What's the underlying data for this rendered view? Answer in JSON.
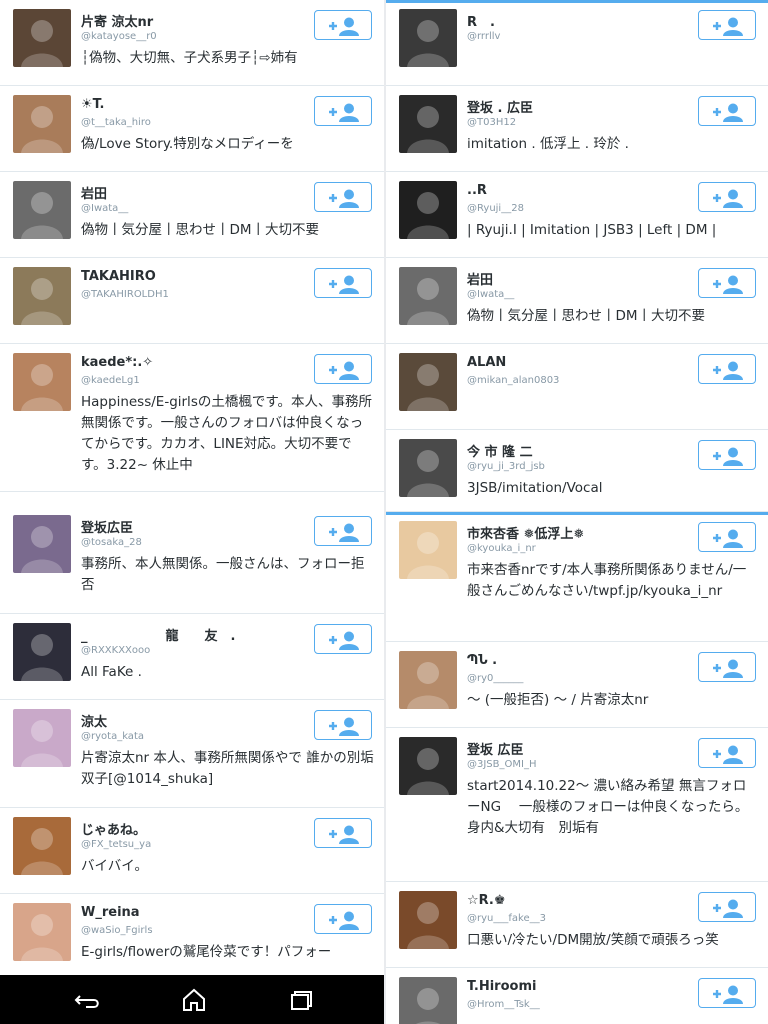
{
  "panels": {
    "top_left": [
      {
        "name": "片寄 涼太nr",
        "handle": "@katayose__r0",
        "bio": "┆偽物、大切無、子犬系男子┆⇨姉有",
        "avatar_color": "#5b4636"
      },
      {
        "name": "☀T.",
        "handle": "@t__taka_hiro",
        "bio": "偽/Love Story.特別なメロディーを",
        "avatar_color": "#a97c5a"
      },
      {
        "name": "岩田",
        "handle": "@Iwata__",
        "bio": "偽物丨気分屋丨思わせ丨DM丨大切不要",
        "avatar_color": "#6b6b6b"
      },
      {
        "name": "TAKAHIRO",
        "handle": "@TAKAHIROLDH1",
        "bio": "",
        "avatar_color": "#8c7a5a"
      },
      {
        "name": "kaede*:.✧",
        "handle": "@kaedeLg1",
        "bio": "Happiness/E-girlsの土橋楓です。本人、事務所無関係です。一般さんのフォロバは仲良くなってからです。カカオ、LINE対応。大切不要です。3.22~ 休止中",
        "avatar_color": "#b7835f"
      }
    ],
    "bottom_left": [
      {
        "name": "登坂広臣",
        "handle": "@tosaka_28",
        "bio": "事務所、本人無関係。一般さんは、フォロー拒否",
        "avatar_color": "#7a6a8e"
      },
      {
        "name": "_　　　　　　龍　　友　.",
        "handle": "@RXXKXXooo",
        "bio": "All FaKe .",
        "avatar_color": "#2d2d3a"
      },
      {
        "name": "涼太",
        "handle": "@ryota_kata",
        "bio": "片寄涼太nr 本人、事務所無関係やで 誰かの別垢 双子[@1014_shuka]",
        "avatar_color": "#c9a9c9"
      },
      {
        "name": "じゃあね。",
        "handle": "@FX_tetsu_ya",
        "bio": "バイバイ。",
        "avatar_color": "#a86a3a"
      },
      {
        "name": "W_reina",
        "handle": "@waSio_Fgirls",
        "bio": "E-girls/flowerの鷲尾伶菜です！パフォー",
        "avatar_color": "#d8a58a"
      }
    ],
    "top_right": [
      {
        "name": "R　.",
        "handle": "@rrrllv",
        "bio": "",
        "avatar_color": "#3a3a3a"
      },
      {
        "name": "登坂 . 広臣",
        "handle": "@T03H12",
        "bio": "imitation . 低浮上 . 玲於 .",
        "avatar_color": "#2a2a2a"
      },
      {
        "name": "..R",
        "handle": "@Ryuji__28",
        "bio": "| Ryuji.I | Imitation | JSB3 | Left | DM |",
        "avatar_color": "#1f1f1f"
      },
      {
        "name": "岩田",
        "handle": "@Iwata__",
        "bio": "偽物丨気分屋丨思わせ丨DM丨大切不要",
        "avatar_color": "#6b6b6b"
      },
      {
        "name": "ALAN",
        "handle": "@mikan_alan0803",
        "bio": "",
        "avatar_color": "#5a4a3a"
      },
      {
        "name": "今 市 隆 二",
        "handle": "@ryu_ji_3rd_jsb",
        "bio": "3JSB/imitation/Vocal",
        "avatar_color": "#4a4a4a"
      }
    ],
    "bottom_right": [
      {
        "name": "市來杏香 ❅低浮上❅",
        "handle": "@kyouka_i_nr",
        "bio": "市来杏香nrです/本人事務所関係ありません/一般さんごめんなさい/twpf.jp/kyouka_i_nr",
        "avatar_color": "#e8c9a0"
      },
      {
        "name": "ՊՆ .",
        "handle": "@ry0______",
        "bio": "〜 (一般拒否) 〜 / 片寄涼太nr",
        "avatar_color": "#b58b6a"
      },
      {
        "name": "登坂 広臣",
        "handle": "@3JSB_OMI_H",
        "bio": "start2014.10.22〜 濃い絡み希望 無言フォローNG　 一般様のフォローは仲良くなったら。　　　　　身内&大切有　別垢有",
        "avatar_color": "#2a2a2a"
      },
      {
        "name": "☆R.♚",
        "handle": "@ryu___fake__3",
        "bio": "口悪い/冷たい/DM開放/笑顔で頑張ろっ笑",
        "avatar_color": "#7a4a2a"
      },
      {
        "name": "T.Hiroomi",
        "handle": "@Hrom__Tsk__",
        "bio": "",
        "avatar_color": "#6a6a6a"
      }
    ]
  },
  "colors": {
    "accent": "#55acee",
    "text": "#292f33",
    "muted": "#8899a6"
  },
  "nav": {
    "back_icon": "back-icon",
    "home_icon": "home-icon",
    "recents_icon": "recents-icon"
  }
}
